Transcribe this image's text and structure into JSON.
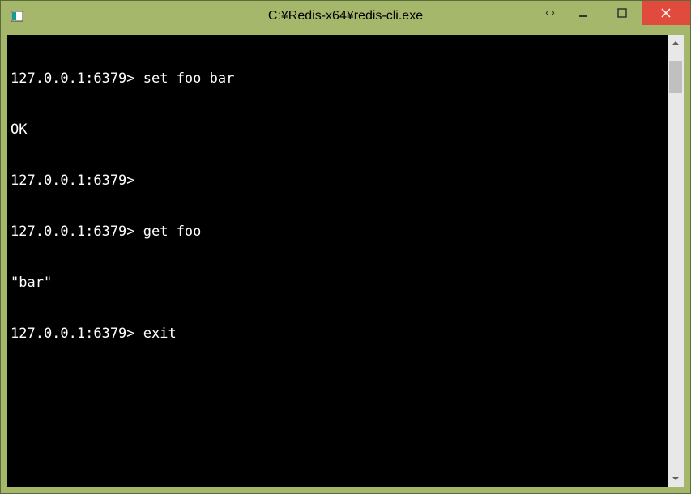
{
  "window": {
    "title": "C:¥Redis-x64¥redis-cli.exe"
  },
  "terminal": {
    "prompt": "127.0.0.1:6379>",
    "lines": [
      "127.0.0.1:6379> set foo bar",
      "OK",
      "127.0.0.1:6379>",
      "127.0.0.1:6379> get foo",
      "\"bar\"",
      "127.0.0.1:6379> exit"
    ]
  }
}
